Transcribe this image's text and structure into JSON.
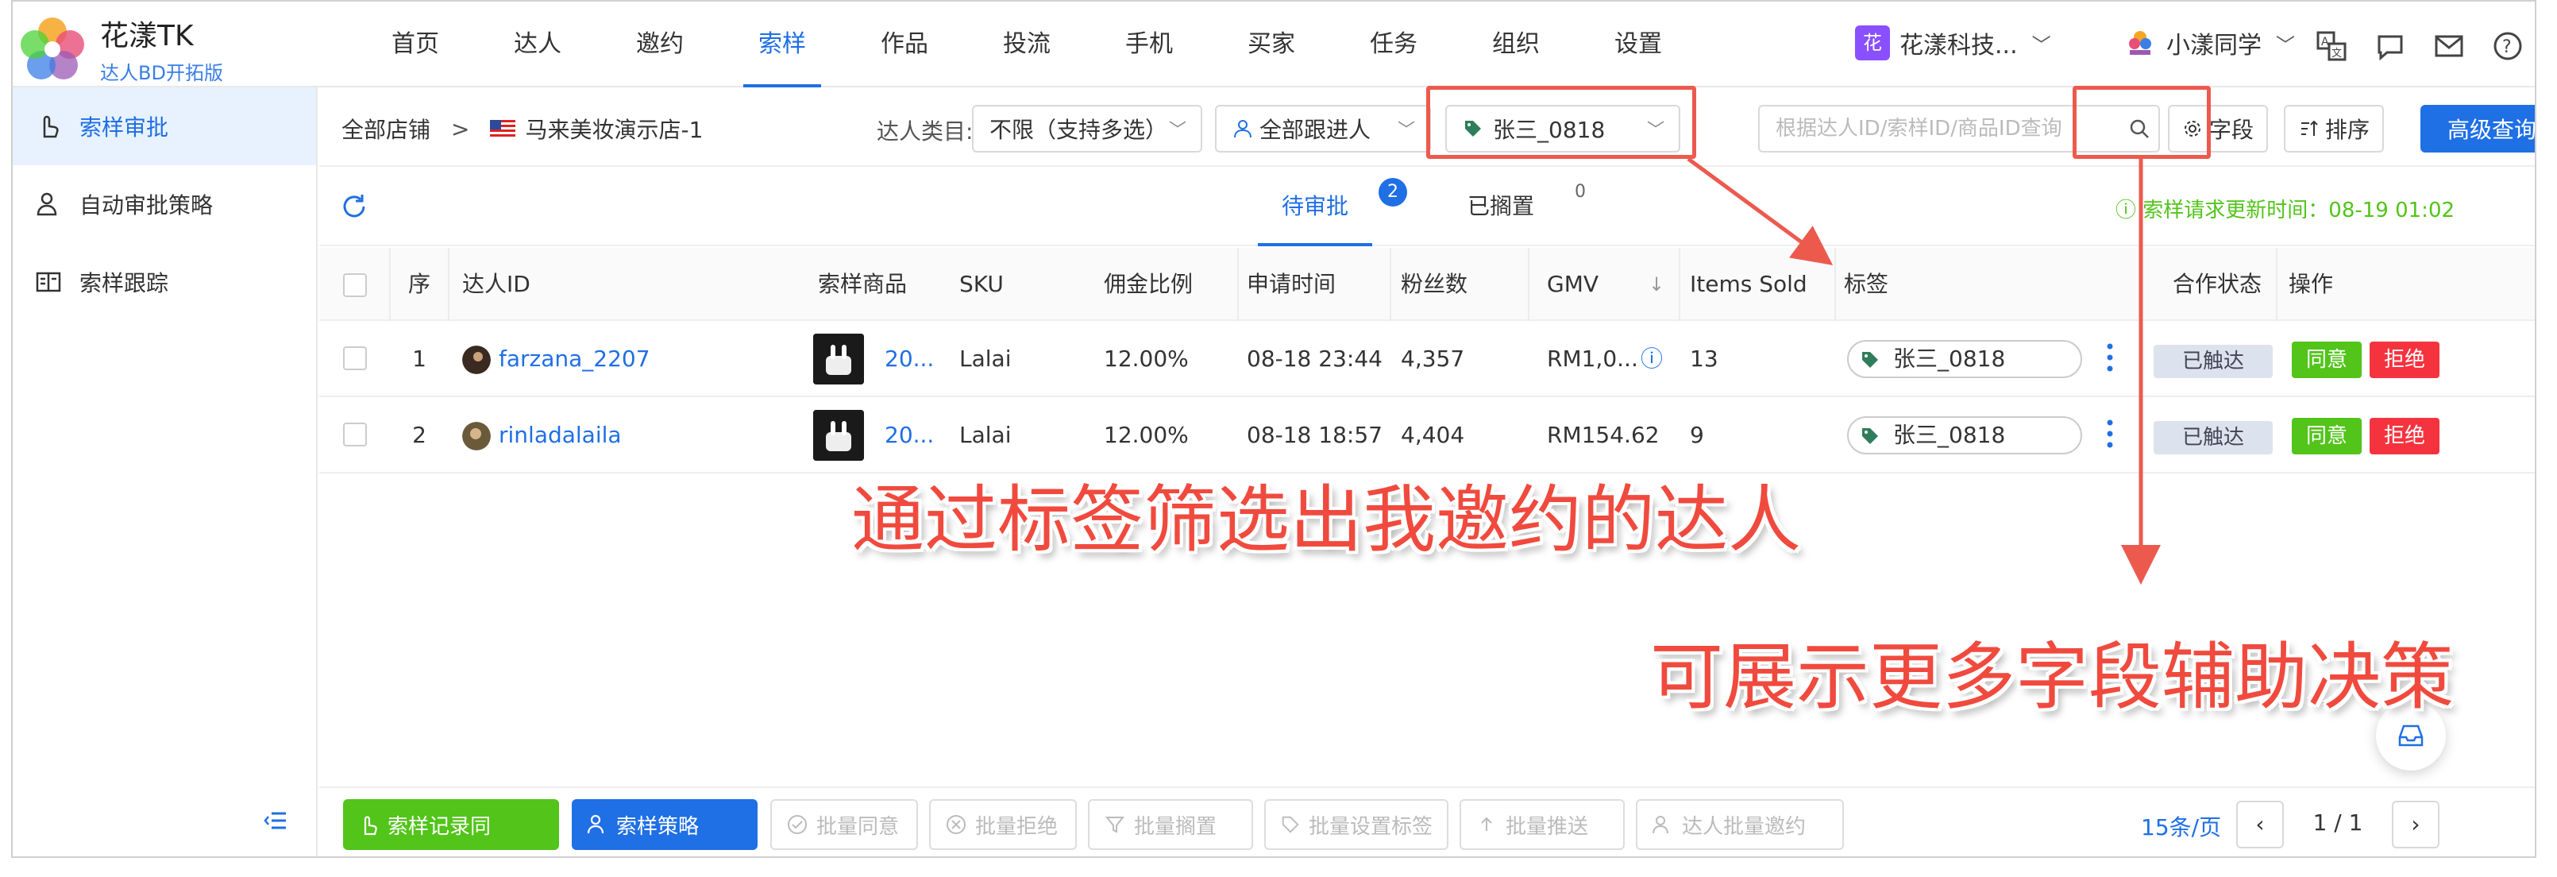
{
  "app": {
    "name": "花漾TK",
    "subtitle": "达人BD开拓版"
  },
  "nav": [
    {
      "label": "首页"
    },
    {
      "label": "达人"
    },
    {
      "label": "邀约"
    },
    {
      "label": "索样",
      "active": true
    },
    {
      "label": "作品"
    },
    {
      "label": "投流"
    },
    {
      "label": "手机"
    },
    {
      "label": "买家"
    },
    {
      "label": "任务"
    },
    {
      "label": "组织"
    },
    {
      "label": "设置"
    }
  ],
  "org": {
    "badge": "花",
    "name": "花漾科技..."
  },
  "user": {
    "name": "小漾同学"
  },
  "sidebar": {
    "items": [
      {
        "label": "索样审批",
        "icon": "hand-pointer-icon",
        "active": true
      },
      {
        "label": "自动审批策略",
        "icon": "user-settings-icon"
      },
      {
        "label": "索样跟踪",
        "icon": "id-card-icon"
      }
    ]
  },
  "filter": {
    "breadcrumb_root": "全部店铺",
    "store": "马来美妆演示店-1",
    "category_label": "达人类目:",
    "category_value": "不限（支持多选）",
    "follower_value": "全部跟进人",
    "tag_value": "张三_0818",
    "search_placeholder": "根据达人ID/索样ID/商品ID查询",
    "fields_button": "字段",
    "sort_button": "排序",
    "advanced_button": "高级查询"
  },
  "tabs": [
    {
      "label": "待审批",
      "count": "2",
      "active": true
    },
    {
      "label": "已搁置",
      "count": "0"
    }
  ],
  "update_time": "索样请求更新时间：08-19 01:02",
  "table": {
    "headers": {
      "seq": "序",
      "creator": "达人ID",
      "product": "索样商品",
      "sku": "SKU",
      "commission": "佣金比例",
      "apply_time": "申请时间",
      "followers": "粉丝数",
      "gmv": "GMV",
      "items_sold": "Items Sold",
      "tag": "标签",
      "status": "合作状态",
      "action": "操作"
    },
    "rows": [
      {
        "seq": "1",
        "creator": "farzana_2207",
        "product": "20...",
        "sku": "Lalai",
        "commission": "12.00%",
        "apply_time": "08-18 23:44",
        "followers": "4,357",
        "gmv": "RM1,0...",
        "items_sold": "13",
        "tag": "张三_0818",
        "status": "已触达",
        "approve": "同意",
        "reject": "拒绝"
      },
      {
        "seq": "2",
        "creator": "rinladalaila",
        "product": "20...",
        "sku": "Lalai",
        "commission": "12.00%",
        "apply_time": "08-18 18:57",
        "followers": "4,404",
        "gmv": "RM154.62",
        "items_sold": "9",
        "tag": "张三_0818",
        "status": "已触达",
        "approve": "同意",
        "reject": "拒绝"
      }
    ]
  },
  "bottom": {
    "records_button": "索样记录同",
    "strategy_button": "索样策略",
    "batch_approve": "批量同意",
    "batch_reject": "批量拒绝",
    "btn5": "批量搁置",
    "btn6": "批量设置标签",
    "btn7": "批量推送",
    "btn8": "达人批量邀约",
    "page_size": "15条/页",
    "page": "1 / 1"
  },
  "annotations": {
    "tag_filter": "通过标签筛选出我邀约的达人",
    "more_fields": "可展示更多字段辅助决策"
  },
  "colors": {
    "primary": "#1f6fe5",
    "success": "#52c41a",
    "danger": "#f5333f",
    "annotation": "#ec5a4e"
  }
}
